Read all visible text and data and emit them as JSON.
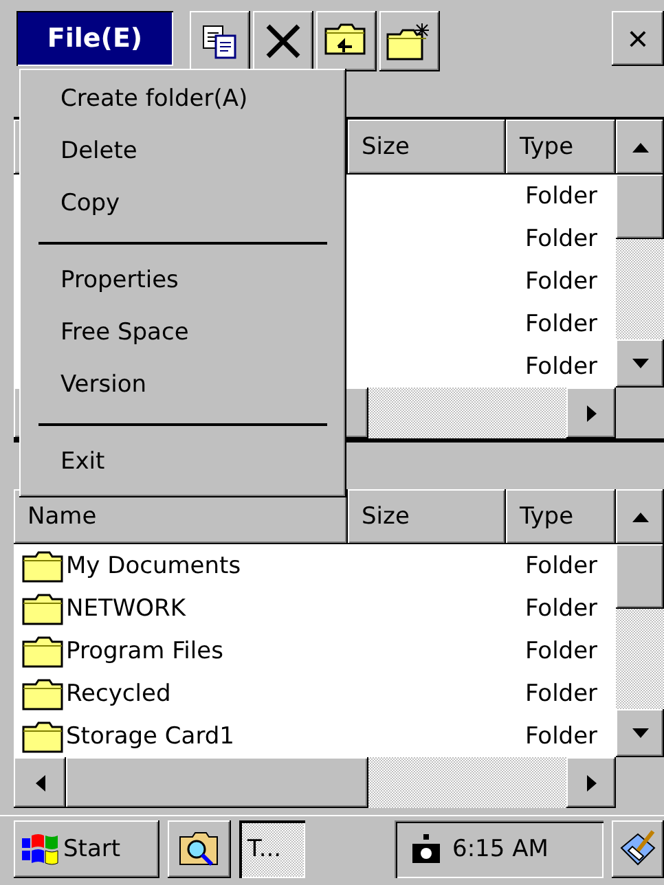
{
  "toolbar": {
    "menu_button": {
      "label": "File(E)",
      "selected": true
    },
    "tools": [
      {
        "kind": "copy"
      },
      {
        "kind": "delete"
      },
      {
        "kind": "up-folder"
      },
      {
        "kind": "new-folder"
      }
    ],
    "close": "×"
  },
  "menu": {
    "items": [
      {
        "kind": "item",
        "label": "Create folder(A)"
      },
      {
        "kind": "item",
        "label": "Delete"
      },
      {
        "kind": "item",
        "label": "Copy"
      },
      {
        "kind": "separator"
      },
      {
        "kind": "item",
        "label": "Properties"
      },
      {
        "kind": "item",
        "label": "Free Space"
      },
      {
        "kind": "item",
        "label": "Version"
      },
      {
        "kind": "separator"
      },
      {
        "kind": "item",
        "label": "Exit"
      }
    ]
  },
  "top_pane": {
    "columns": [
      {
        "kind": "size",
        "label": "Size"
      },
      {
        "kind": "type",
        "label": "Type"
      }
    ],
    "rows": [
      {
        "type": "Folder"
      },
      {
        "type": "Folder"
      },
      {
        "type": "Folder"
      },
      {
        "type": "Folder"
      },
      {
        "type": "Folder"
      }
    ]
  },
  "bottom_pane": {
    "columns": [
      {
        "kind": "name",
        "label": "Name"
      },
      {
        "kind": "size",
        "label": "Size"
      },
      {
        "kind": "type",
        "label": "Type"
      }
    ],
    "rows": [
      {
        "name": "My Documents",
        "type": "Folder"
      },
      {
        "name": "NETWORK",
        "type": "Folder"
      },
      {
        "name": "Program Files",
        "type": "Folder"
      },
      {
        "name": "Recycled",
        "type": "Folder"
      },
      {
        "name": "Storage Card1",
        "type": "Folder"
      }
    ]
  },
  "taskbar": {
    "start": "Start",
    "tasks": [
      {
        "kind": "icon",
        "selected": false
      },
      {
        "kind": "text",
        "label": "T...",
        "selected": true
      }
    ],
    "clock": "6:15 AM"
  }
}
